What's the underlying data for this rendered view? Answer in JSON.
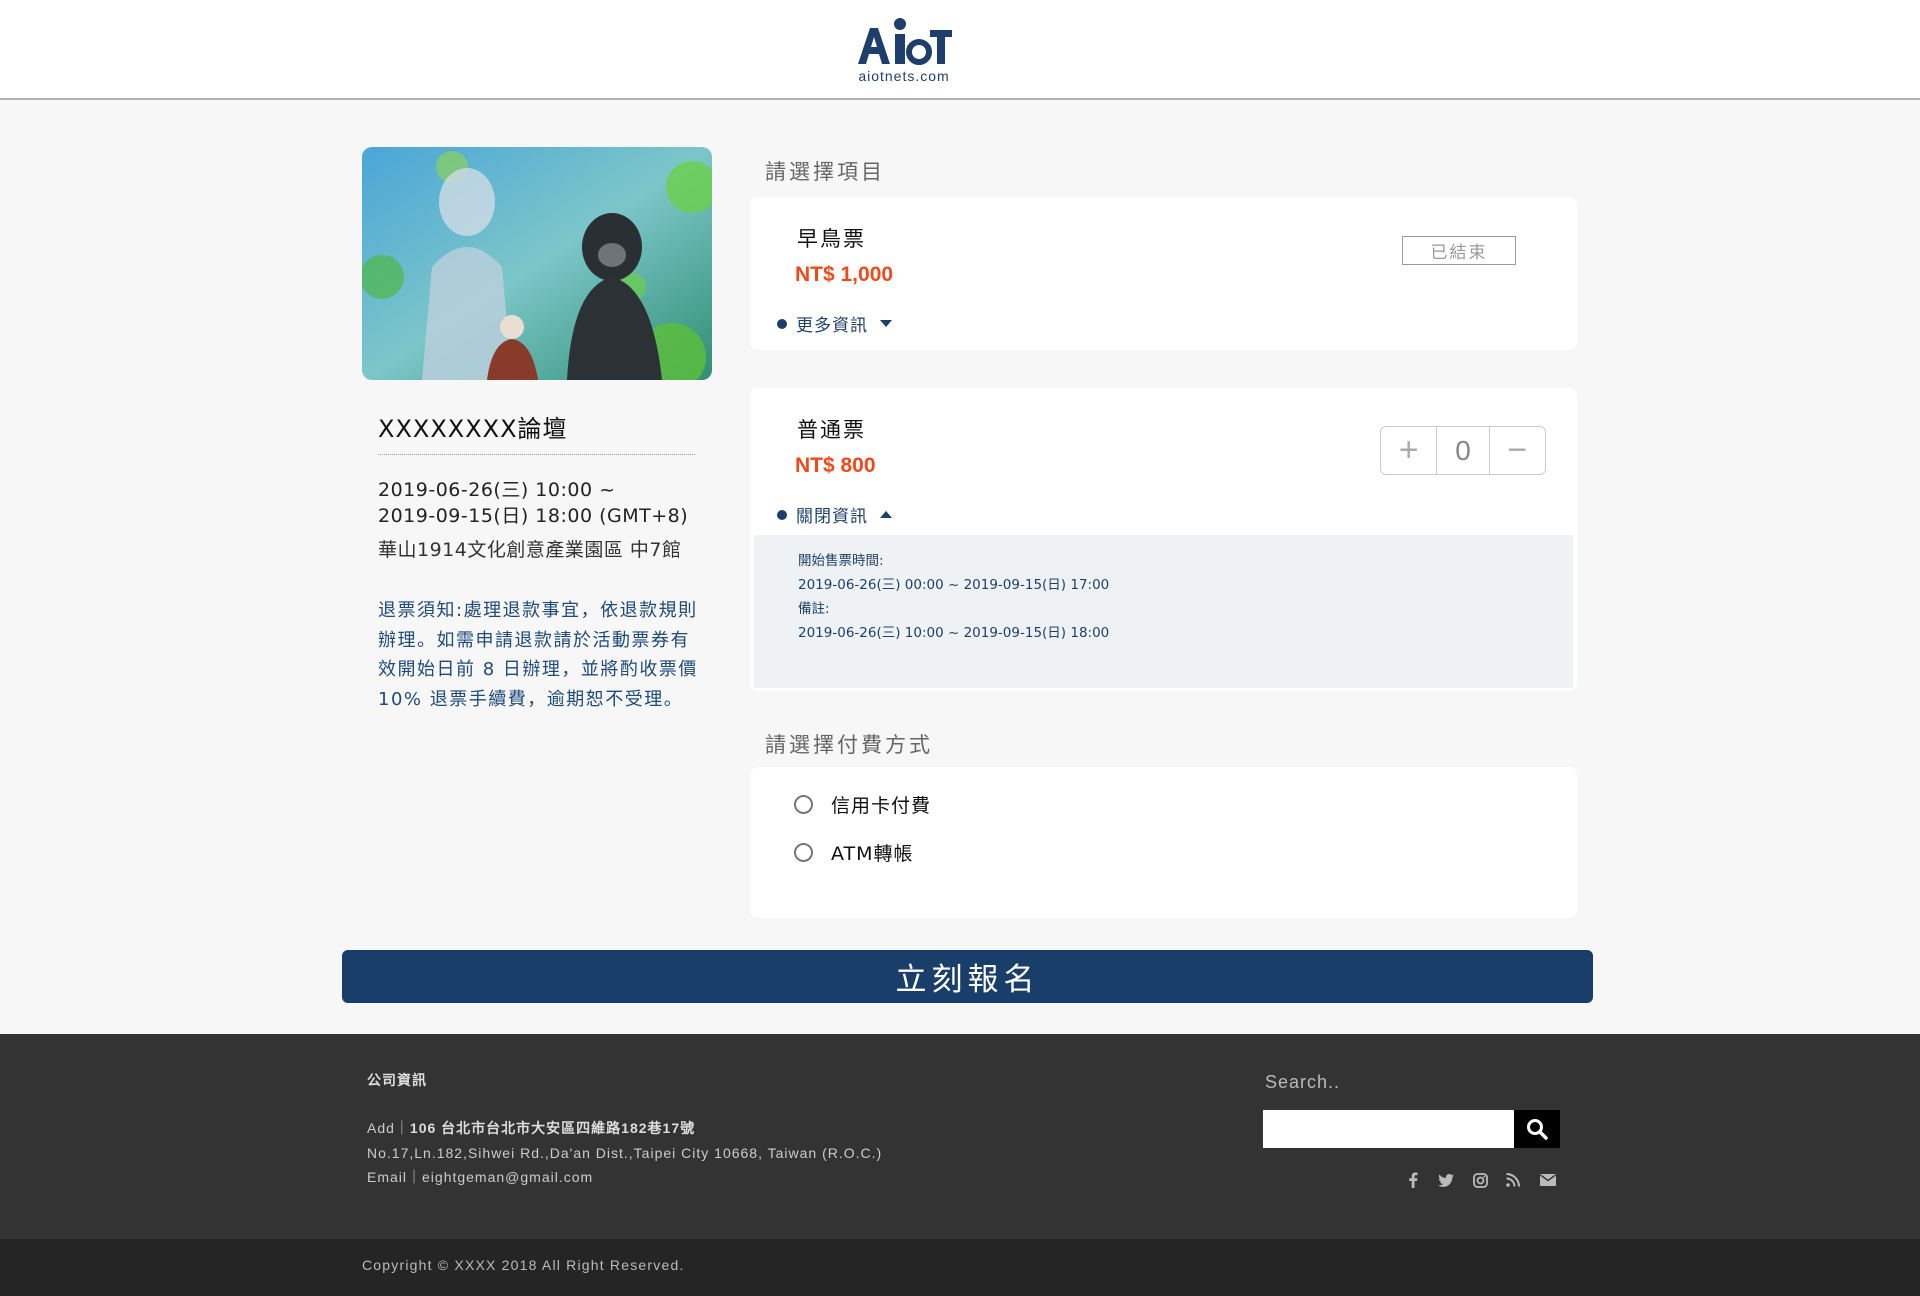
{
  "header": {
    "logo_sub": "aiotnets.com"
  },
  "event": {
    "title": "XXXXXXXX論壇",
    "date_line1": "2019-06-26(三) 10:00 ~",
    "date_line2": "2019-09-15(日) 18:00 (GMT+8)",
    "venue": "華山1914文化創意產業園區 中7館",
    "refund_note": "退票須知:處理退款事宜，依退款規則辦理。如需申請退款請於活動票券有效開始日前 8 日辦理，並將酌收票價10% 退票手續費，逾期恕不受理。"
  },
  "tickets_section": {
    "title": "請選擇項目"
  },
  "ticket_early": {
    "name": "早鳥票",
    "price": "NT$ 1,000",
    "toggle_label": "更多資訊",
    "status": "已結束"
  },
  "ticket_regular": {
    "name": "普通票",
    "price": "NT$ 800",
    "toggle_label": "關閉資訊",
    "quantity": "0",
    "info": {
      "sale_label": "開始售票時間:",
      "sale_period": "2019-06-26(三) 00:00 ~ 2019-09-15(日) 17:00",
      "note_label": "備註:",
      "note_period": "2019-06-26(三) 10:00 ~ 2019-09-15(日) 18:00"
    }
  },
  "payment_section": {
    "title": "請選擇付費方式",
    "options": [
      "信用卡付費",
      "ATM轉帳"
    ]
  },
  "submit_label": "立刻報名",
  "footer": {
    "heading": "公司資訊",
    "add_label": "Add｜",
    "address_zh": "106 台北市台北市大安區四維路182巷17號",
    "address_en": "No.17,Ln.182,Sihwei Rd.,Da'an Dist.,Taipei City 10668, Taiwan (R.O.C.)",
    "email_line": "Email｜eightgeman@gmail.com",
    "search_label": "Search..",
    "social_icons": [
      "facebook-icon",
      "twitter-icon",
      "instagram-icon",
      "rss-icon",
      "email-icon"
    ],
    "copyright": "Copyright © XXXX 2018 All Right Reserved."
  },
  "colors": {
    "brand_navy": "#1a3e6a",
    "price_orange": "#f04a1c",
    "footer_dark": "#333333",
    "footer_darker": "#252525"
  }
}
